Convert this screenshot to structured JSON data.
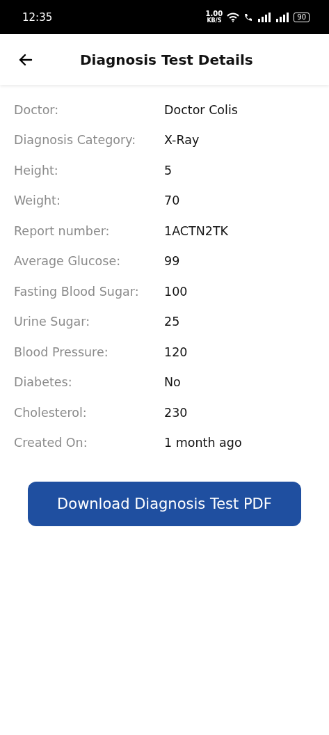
{
  "status_bar": {
    "time": "12:35",
    "speed": "1.00",
    "speed_unit": "KB/S",
    "battery": "90"
  },
  "app_bar": {
    "title": "Diagnosis Test Details"
  },
  "details": [
    {
      "label": "Doctor:",
      "value": "Doctor Colis"
    },
    {
      "label": "Diagnosis Category:",
      "value": "X-Ray"
    },
    {
      "label": "Height:",
      "value": "5"
    },
    {
      "label": "Weight:",
      "value": "70"
    },
    {
      "label": "Report number:",
      "value": "1ACTN2TK"
    },
    {
      "label": "Average Glucose:",
      "value": "99"
    },
    {
      "label": "Fasting Blood Sugar:",
      "value": "100"
    },
    {
      "label": "Urine Sugar:",
      "value": "25"
    },
    {
      "label": "Blood Pressure:",
      "value": "120"
    },
    {
      "label": "Diabetes:",
      "value": "No"
    },
    {
      "label": "Cholesterol:",
      "value": "230"
    },
    {
      "label": "Created On:",
      "value": "1 month ago"
    }
  ],
  "download_button": "Download Diagnosis Test PDF"
}
